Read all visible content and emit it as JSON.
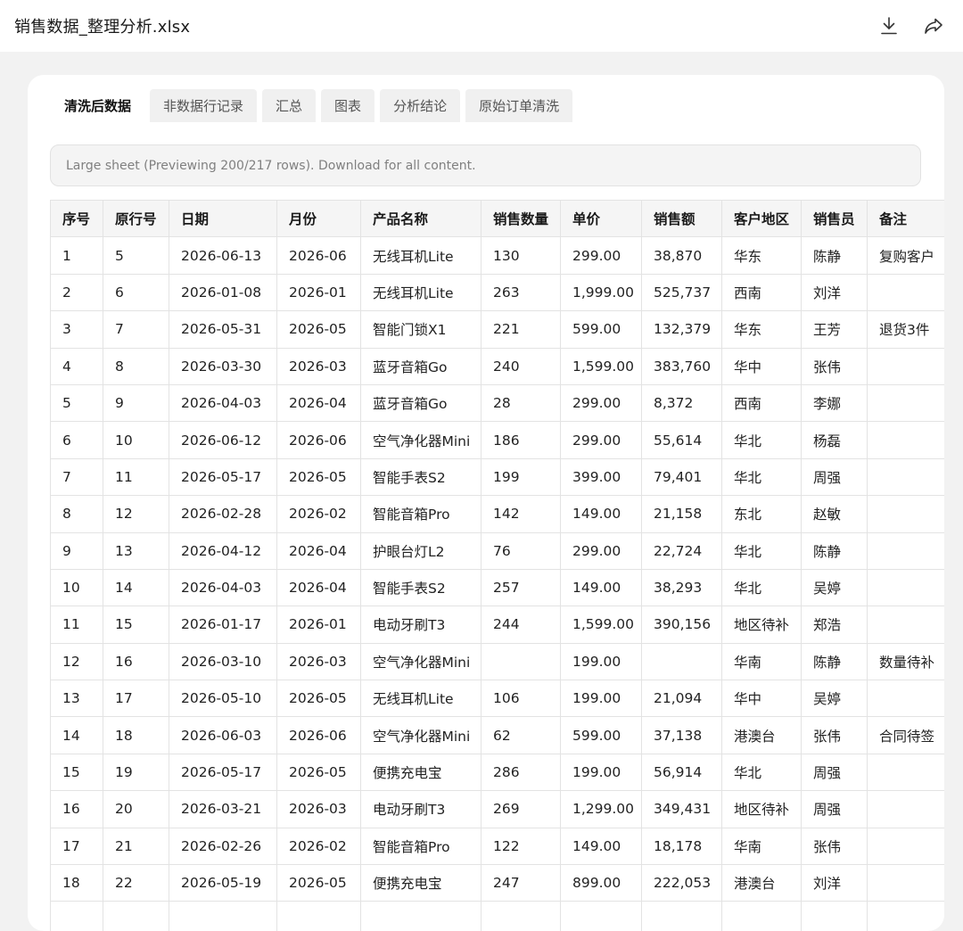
{
  "header": {
    "file_title": "销售数据_整理分析.xlsx"
  },
  "tabs": [
    {
      "label": "清洗后数据",
      "active": true
    },
    {
      "label": "非数据行记录",
      "active": false
    },
    {
      "label": "汇总",
      "active": false
    },
    {
      "label": "图表",
      "active": false
    },
    {
      "label": "分析结论",
      "active": false
    },
    {
      "label": "原始订单清洗",
      "active": false
    }
  ],
  "notice": "Large sheet (Previewing 200/217 rows). Download for all content.",
  "table": {
    "columns": [
      "序号",
      "原行号",
      "日期",
      "月份",
      "产品名称",
      "销售数量",
      "单价",
      "销售额",
      "客户地区",
      "销售员",
      "备注"
    ],
    "rows": [
      [
        "1",
        "5",
        "2026-06-13",
        "2026-06",
        "无线耳机Lite",
        "130",
        "299.00",
        "38,870",
        "华东",
        "陈静",
        "复购客户"
      ],
      [
        "2",
        "6",
        "2026-01-08",
        "2026-01",
        "无线耳机Lite",
        "263",
        "1,999.00",
        "525,737",
        "西南",
        "刘洋",
        ""
      ],
      [
        "3",
        "7",
        "2026-05-31",
        "2026-05",
        "智能门锁X1",
        "221",
        "599.00",
        "132,379",
        "华东",
        "王芳",
        "退货3件"
      ],
      [
        "4",
        "8",
        "2026-03-30",
        "2026-03",
        "蓝牙音箱Go",
        "240",
        "1,599.00",
        "383,760",
        "华中",
        "张伟",
        ""
      ],
      [
        "5",
        "9",
        "2026-04-03",
        "2026-04",
        "蓝牙音箱Go",
        "28",
        "299.00",
        "8,372",
        "西南",
        "李娜",
        ""
      ],
      [
        "6",
        "10",
        "2026-06-12",
        "2026-06",
        "空气净化器Mini",
        "186",
        "299.00",
        "55,614",
        "华北",
        "杨磊",
        ""
      ],
      [
        "7",
        "11",
        "2026-05-17",
        "2026-05",
        "智能手表S2",
        "199",
        "399.00",
        "79,401",
        "华北",
        "周强",
        ""
      ],
      [
        "8",
        "12",
        "2026-02-28",
        "2026-02",
        "智能音箱Pro",
        "142",
        "149.00",
        "21,158",
        "东北",
        "赵敏",
        ""
      ],
      [
        "9",
        "13",
        "2026-04-12",
        "2026-04",
        "护眼台灯L2",
        "76",
        "299.00",
        "22,724",
        "华北",
        "陈静",
        ""
      ],
      [
        "10",
        "14",
        "2026-04-03",
        "2026-04",
        "智能手表S2",
        "257",
        "149.00",
        "38,293",
        "华北",
        "吴婷",
        ""
      ],
      [
        "11",
        "15",
        "2026-01-17",
        "2026-01",
        "电动牙刷T3",
        "244",
        "1,599.00",
        "390,156",
        "地区待补",
        "郑浩",
        ""
      ],
      [
        "12",
        "16",
        "2026-03-10",
        "2026-03",
        "空气净化器Mini",
        "",
        "199.00",
        "",
        "华南",
        "陈静",
        "数量待补"
      ],
      [
        "13",
        "17",
        "2026-05-10",
        "2026-05",
        "无线耳机Lite",
        "106",
        "199.00",
        "21,094",
        "华中",
        "吴婷",
        ""
      ],
      [
        "14",
        "18",
        "2026-06-03",
        "2026-06",
        "空气净化器Mini",
        "62",
        "599.00",
        "37,138",
        "港澳台",
        "张伟",
        "合同待签"
      ],
      [
        "15",
        "19",
        "2026-05-17",
        "2026-05",
        "便携充电宝",
        "286",
        "199.00",
        "56,914",
        "华北",
        "周强",
        ""
      ],
      [
        "16",
        "20",
        "2026-03-21",
        "2026-03",
        "电动牙刷T3",
        "269",
        "1,299.00",
        "349,431",
        "地区待补",
        "周强",
        ""
      ],
      [
        "17",
        "21",
        "2026-02-26",
        "2026-02",
        "智能音箱Pro",
        "122",
        "149.00",
        "18,178",
        "华南",
        "张伟",
        ""
      ],
      [
        "18",
        "22",
        "2026-05-19",
        "2026-05",
        "便携充电宝",
        "247",
        "899.00",
        "222,053",
        "港澳台",
        "刘洋",
        ""
      ],
      [
        "",
        "",
        "",
        "",
        "",
        "",
        "",
        "",
        "",
        "",
        ""
      ]
    ]
  }
}
